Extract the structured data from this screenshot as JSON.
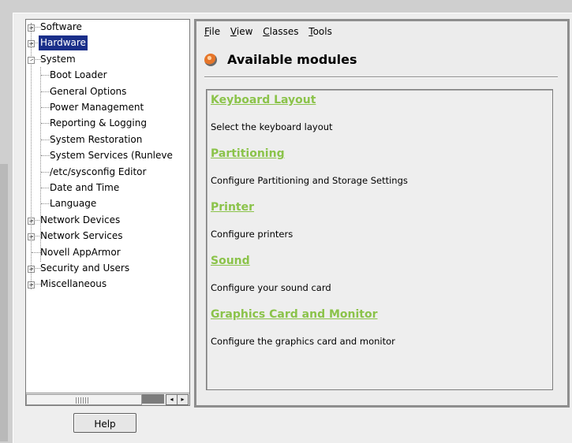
{
  "tree": {
    "items": [
      {
        "label": "Software",
        "expander": "+"
      },
      {
        "label": "Hardware",
        "expander": "+",
        "selected": true
      },
      {
        "label": "System",
        "expander": "-"
      },
      {
        "label": "Boot Loader"
      },
      {
        "label": "General Options"
      },
      {
        "label": "Power Management"
      },
      {
        "label": "Reporting & Logging"
      },
      {
        "label": "System Restoration"
      },
      {
        "label": "System Services (Runleve"
      },
      {
        "label": "/etc/sysconfig Editor"
      },
      {
        "label": "Date and Time"
      },
      {
        "label": "Language"
      },
      {
        "label": "Network Devices",
        "expander": "+"
      },
      {
        "label": "Network Services",
        "expander": "+"
      },
      {
        "label": "Novell AppArmor"
      },
      {
        "label": "Security and Users",
        "expander": "+"
      },
      {
        "label": "Miscellaneous",
        "expander": "+"
      }
    ]
  },
  "scrollbar": {
    "left_arrow": "◂",
    "right_arrow": "▸"
  },
  "help_label": "Help",
  "menu": {
    "file": {
      "mnemonic": "F",
      "rest": "ile"
    },
    "view": {
      "mnemonic": "V",
      "rest": "iew"
    },
    "classes": {
      "mnemonic": "C",
      "rest": "lasses"
    },
    "tools": {
      "mnemonic": "T",
      "rest": "ools"
    }
  },
  "page_title": "Available modules",
  "app_icon": "yast-icon",
  "accent_link_color": "#8bc34a",
  "selection_color": "#1a2f8a",
  "modules": [
    {
      "title": "Keyboard Layout",
      "description": "Select the keyboard layout"
    },
    {
      "title": "Partitioning",
      "description": "Configure Partitioning and Storage Settings"
    },
    {
      "title": "Printer",
      "description": "Configure printers"
    },
    {
      "title": "Sound",
      "description": "Configure your sound card"
    },
    {
      "title": "Graphics Card and Monitor",
      "description": "Configure the graphics card and monitor"
    }
  ]
}
